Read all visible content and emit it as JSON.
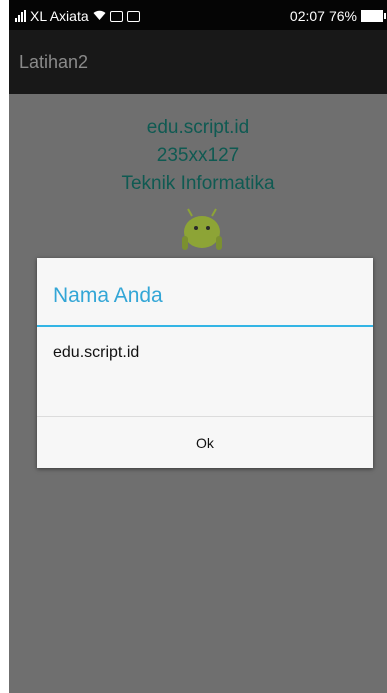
{
  "status_bar": {
    "carrier": "XL Axiata",
    "time": "02:07",
    "battery": "76%"
  },
  "app_bar": {
    "title": "Latihan2"
  },
  "content": {
    "line1": "edu.script.id",
    "line2": "235xx127",
    "line3": "Teknik Informatika"
  },
  "dialog": {
    "title": "Nama Anda",
    "message": "edu.script.id",
    "ok_label": "Ok"
  },
  "colors": {
    "accent": "#33b5e5",
    "title_text": "#33a6d6",
    "content_text": "#0f5a52",
    "dimmed_bg": "#6f6f6f"
  }
}
